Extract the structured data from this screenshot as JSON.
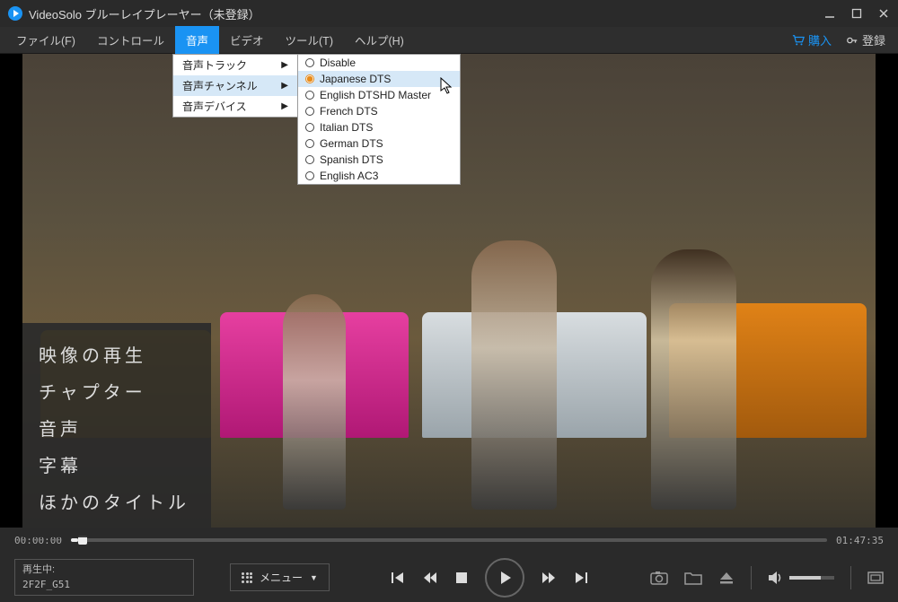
{
  "titlebar": {
    "title": "VideoSolo ブルーレイプレーヤー（未登録）"
  },
  "menubar": {
    "file": "ファイル(F)",
    "control": "コントロール",
    "audio": "音声",
    "video": "ビデオ",
    "tool": "ツール(T)",
    "help": "ヘルプ(H)",
    "buy": "購入",
    "login": "登録"
  },
  "submenu_audio": {
    "track": "音声トラック",
    "channel": "音声チャンネル",
    "device": "音声デバイス"
  },
  "submenu_channel": [
    {
      "label": "Disable",
      "selected": false
    },
    {
      "label": "Japanese DTS",
      "selected": true
    },
    {
      "label": "English DTSHD Master",
      "selected": false
    },
    {
      "label": "French DTS",
      "selected": false
    },
    {
      "label": "Italian DTS",
      "selected": false
    },
    {
      "label": "German DTS",
      "selected": false
    },
    {
      "label": "Spanish DTS",
      "selected": false
    },
    {
      "label": "English AC3",
      "selected": false
    }
  ],
  "overlay_menu": {
    "playback": "映像の再生",
    "chapter": "チャプター",
    "audio": "音声",
    "subtitle": "字幕",
    "other": "ほかのタイトル"
  },
  "seek": {
    "current": "00:00:00",
    "total": "01:47:35"
  },
  "nowplaying": {
    "label": "再生中:",
    "title": "2F2F_G51"
  },
  "menu_button": "メニュー"
}
